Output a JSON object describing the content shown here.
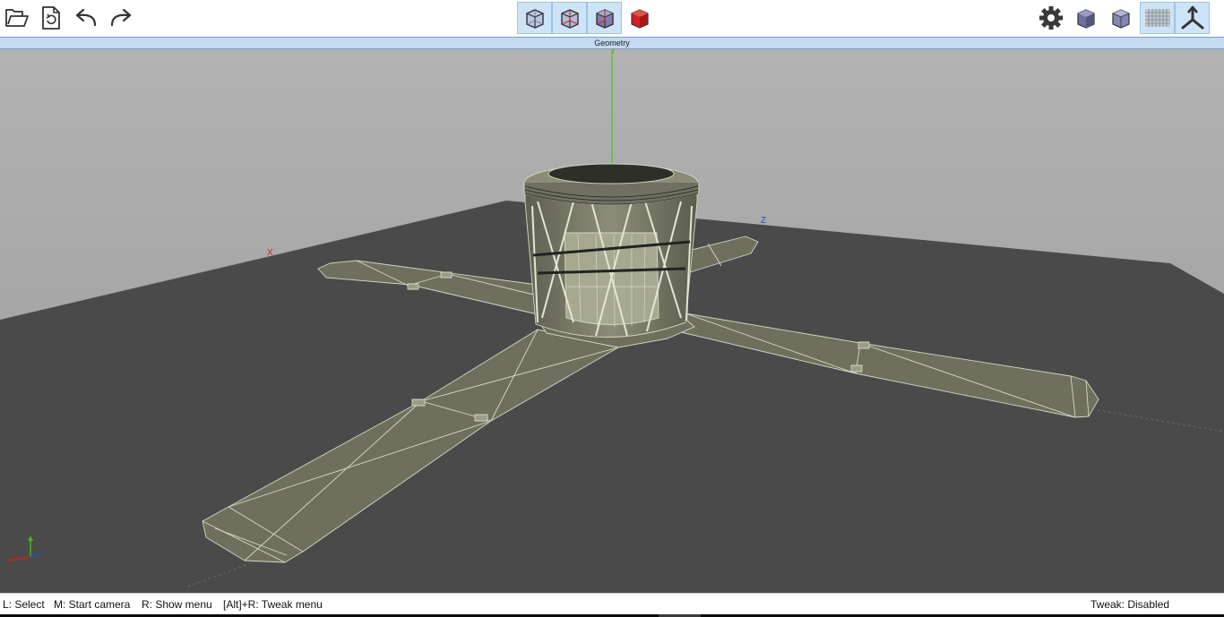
{
  "toolbar": {
    "left": [
      {
        "name": "open-folder-icon"
      },
      {
        "name": "reload-file-icon"
      },
      {
        "name": "undo-icon"
      },
      {
        "name": "redo-icon"
      }
    ],
    "view_modes": [
      {
        "name": "wireframe-cube-icon",
        "active": true
      },
      {
        "name": "wireframe-red-edges-cube-icon",
        "active": true
      },
      {
        "name": "solid-wireframe-cube-icon",
        "active": true
      },
      {
        "name": "solid-red-cube-icon",
        "active": false
      }
    ],
    "right": [
      {
        "name": "settings-gear-icon",
        "active": false
      },
      {
        "name": "shaded-cube-icon",
        "active": false
      },
      {
        "name": "outline-cube-icon",
        "active": false
      },
      {
        "name": "ground-grid-icon",
        "active": true
      },
      {
        "name": "axes-gizmo-icon",
        "active": true
      }
    ]
  },
  "tab": {
    "label": "Geometry"
  },
  "viewport": {
    "axis_x_label": "X",
    "axis_y_label": "Y",
    "axis_z_label": "Z",
    "colors": {
      "background": "#a5a5a5",
      "ground": "#4a4a4a",
      "model_fill": "#6e6f5c",
      "model_edges": "#d6d9c4",
      "axis_x": "#d02020",
      "axis_y": "#4caf20",
      "axis_z": "#2050d0"
    }
  },
  "status": {
    "select": "L: Select",
    "camera": "M: Start camera",
    "menu": "R: Show menu",
    "tweak_menu": "[Alt]+R: Tweak menu",
    "tweak_state": "Tweak: Disabled"
  }
}
